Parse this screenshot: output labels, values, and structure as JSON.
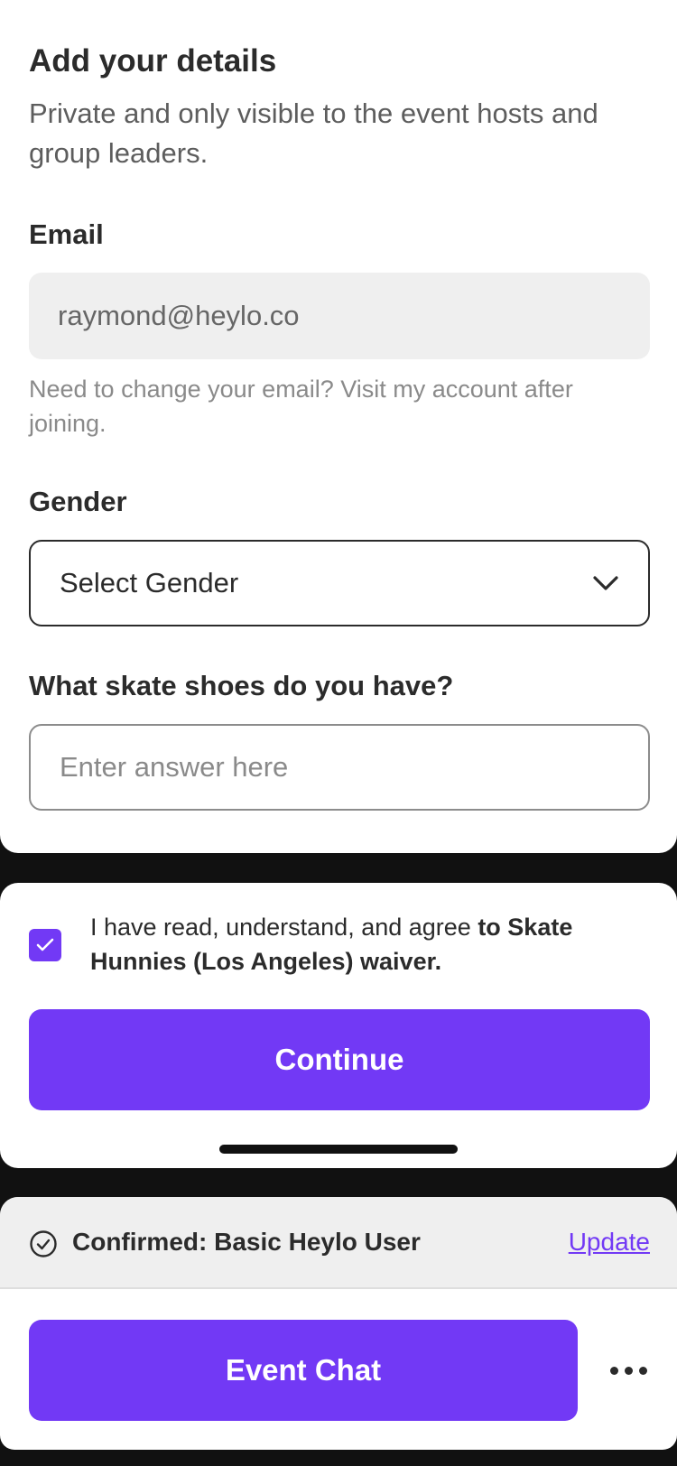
{
  "details": {
    "title": "Add your details",
    "subtitle": "Private and only visible to the event hosts and group leaders.",
    "email_label": "Email",
    "email_value": "raymond@heylo.co",
    "email_hint": "Need to change your email? Visit my account after joining.",
    "gender_label": "Gender",
    "gender_value": "Select Gender",
    "question_label": "What skate shoes do you have?",
    "answer_placeholder": "Enter answer here"
  },
  "waiver": {
    "checked": true,
    "text_plain": "I have read, understand, and agree ",
    "text_bold": "to Skate Hunnies (Los Angeles) waiver.",
    "continue_label": "Continue"
  },
  "membership": {
    "confirmed_text": "Confirmed: Basic Heylo User",
    "update_label": "Update"
  },
  "actions": {
    "chat_label": "Event Chat",
    "more_icon": "more-horizontal-icon"
  },
  "colors": {
    "accent": "#7239F5",
    "backdrop": "#111111",
    "input_fill": "#EFEFEF"
  }
}
